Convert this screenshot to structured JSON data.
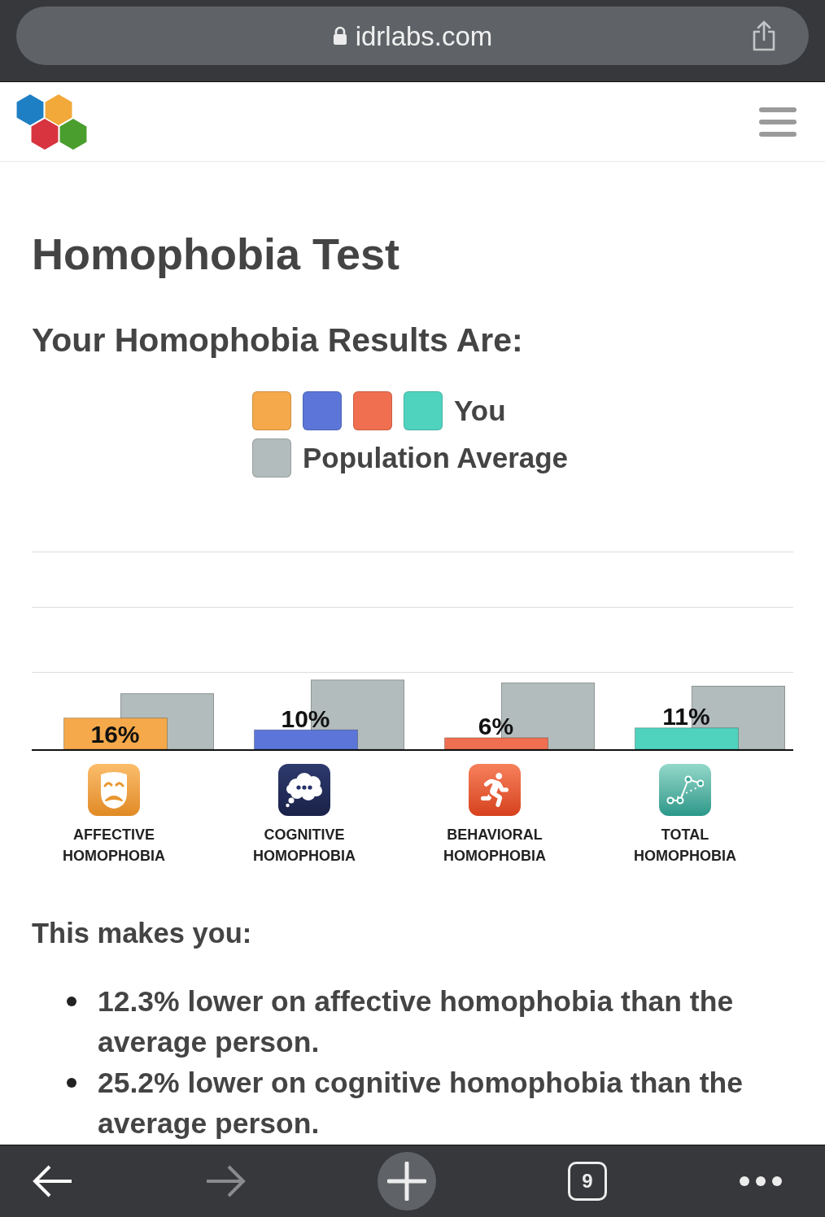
{
  "browser_bar": {
    "url": "idrlabs.com",
    "secure": true
  },
  "title": "Homophobia Test",
  "results_heading": "Your Homophobia Results Are:",
  "results_chart": {
    "chart_data": {
      "type": "bar",
      "categories": [
        "AFFECTIVE HOMOPHOBIA",
        "COGNITIVE HOMOPHOBIA",
        "BEHAVIORAL HOMOPHOBIA",
        "TOTAL HOMOPHOBIA"
      ],
      "series": [
        {
          "name": "You",
          "colors": [
            "#f5a94a",
            "#5b76d8",
            "#ef6f50",
            "#4fd3bf"
          ],
          "values": [
            16,
            10,
            6,
            11
          ],
          "value_labels": [
            "16%",
            "10%",
            "6%",
            "11%"
          ]
        },
        {
          "name": "Population Average",
          "color": "#b3bcbc",
          "values": [
            28.3,
            35.2,
            33.7,
            32.1
          ]
        }
      ]
    }
  },
  "summary": {
    "heading": "This makes you:",
    "items": [
      "12.3% lower on affective homophobia than the average person.",
      "25.2% lower on cognitive homophobia than the average person."
    ]
  },
  "toolbar": [
    {
      "kind": "back",
      "disabled": false
    },
    {
      "kind": "forward",
      "disabled": true
    },
    {
      "kind": "new_tab"
    },
    {
      "kind": "tabs",
      "label": "9"
    },
    {
      "kind": "more"
    }
  ]
}
